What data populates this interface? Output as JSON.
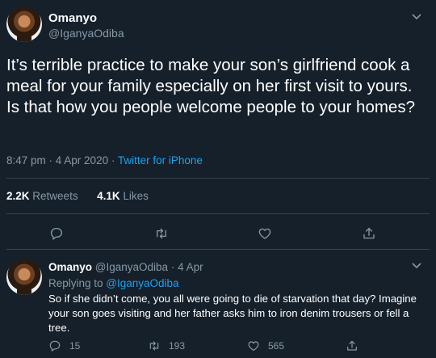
{
  "main_tweet": {
    "display_name": "Omanyo",
    "handle": "@IganyaOdiba",
    "text": "It’s terrible practice to make your son’s girlfriend cook a meal for your family especially on her first visit to yours. Is that how you people welcome people to your homes?",
    "time_date": "8:47 pm · 4 Apr 2020 · ",
    "source": "Twitter for iPhone",
    "retweets_count": "2.2K",
    "retweets_label": "Retweets",
    "likes_count": "4.1K",
    "likes_label": "Likes",
    "icons": [
      "reply-icon",
      "retweet-icon",
      "like-icon",
      "share-icon"
    ]
  },
  "reply_tweet": {
    "display_name": "Omanyo",
    "handle": "@IganyaOdiba",
    "separator": "·",
    "date": "4 Apr",
    "replying_prefix": "Replying to ",
    "replying_to": "@IganyaOdiba",
    "text": "So if she didn’t come, you all were going to die of starvation that day? Imagine your son goes visiting and her father asks him to iron denim trousers or fell a tree.",
    "reply_count": "15",
    "retweet_count": "193",
    "like_count": "565"
  },
  "colors": {
    "background": "#15202b",
    "text": "#ffffff",
    "muted": "#8899a6",
    "accent": "#1da1f2",
    "divider": "#38444d"
  }
}
